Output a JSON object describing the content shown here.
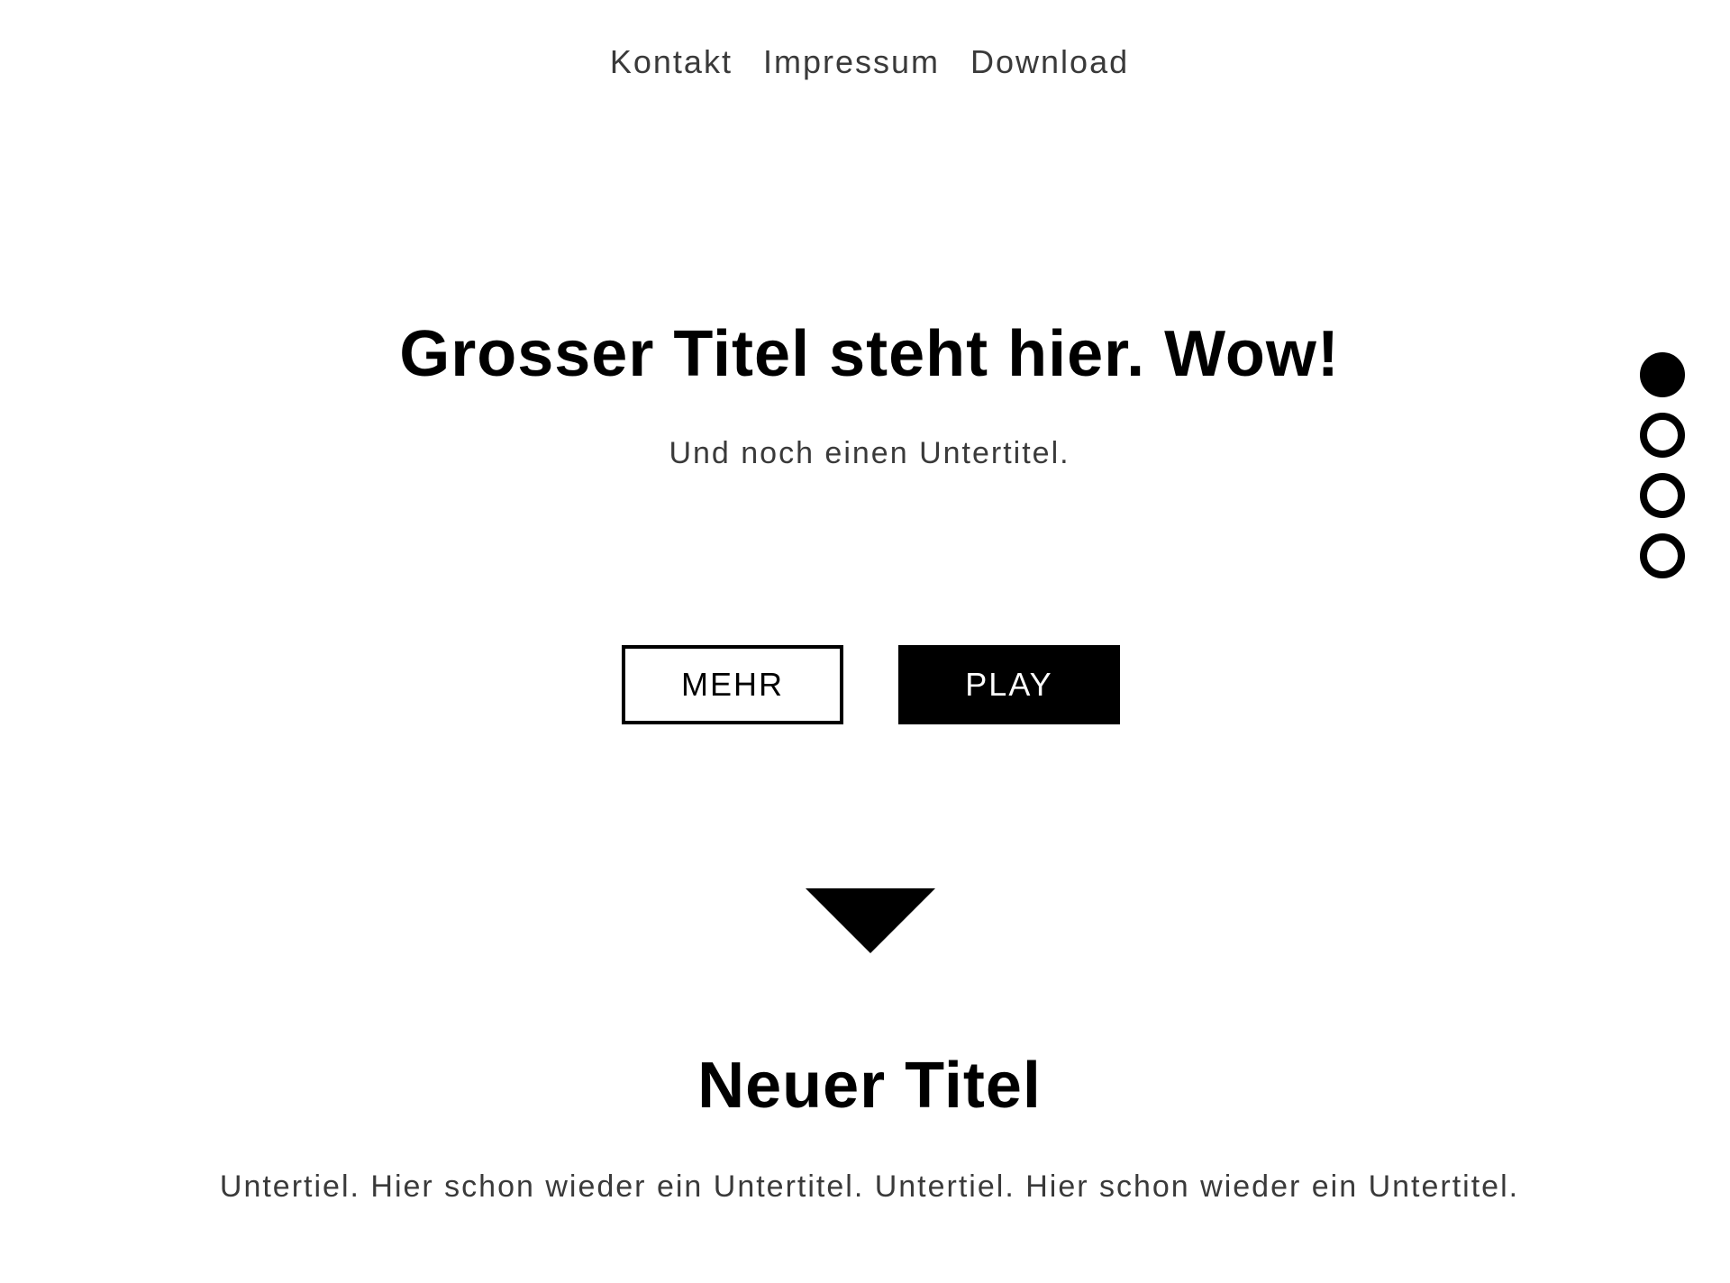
{
  "nav": {
    "links": [
      "Kontakt",
      "Impressum",
      "Download"
    ]
  },
  "hero": {
    "title": "Grosser Titel steht hier. Wow!",
    "subtitle": "Und noch einen Untertitel.",
    "more_button": "MEHR",
    "play_button": "PLAY"
  },
  "section": {
    "title": "Neuer Titel",
    "subtitle": "Untertiel. Hier schon wieder ein Untertitel. Untertiel. Hier schon wieder ein Untertitel."
  },
  "dot_nav": {
    "count": 4,
    "active_index": 0
  },
  "icons": {
    "scroll_down": "triangle-down-icon"
  },
  "colors": {
    "text": "#000000",
    "muted_text": "#3a3a3a",
    "background": "#ffffff",
    "accent": "#000000"
  }
}
